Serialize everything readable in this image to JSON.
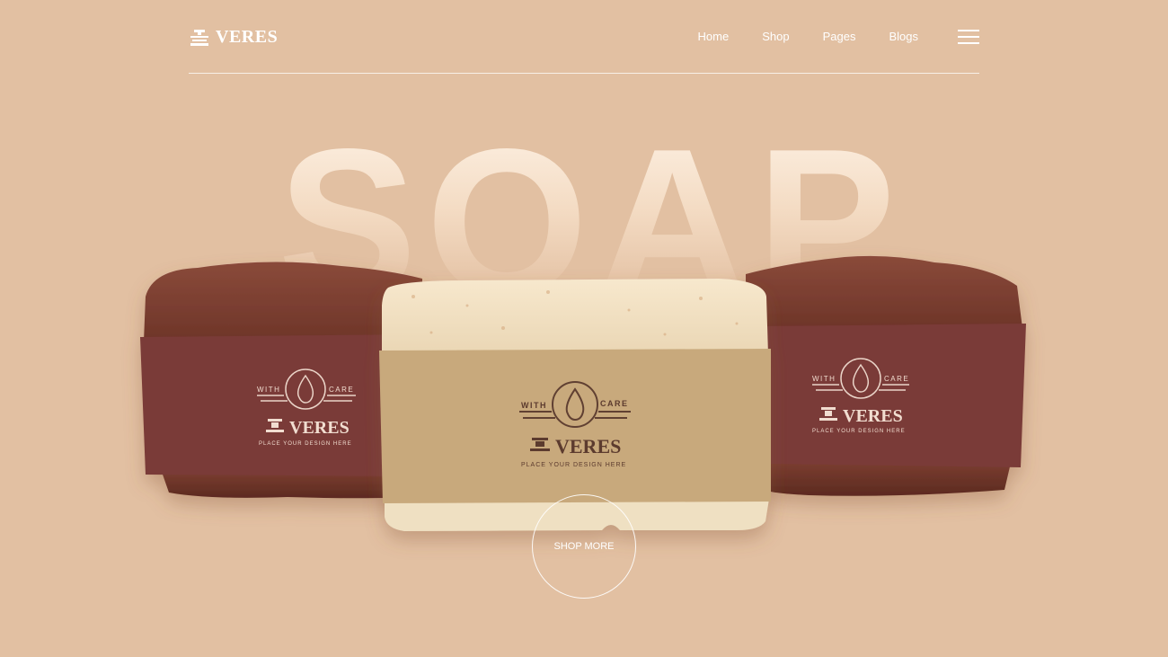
{
  "brand": {
    "name": "VERES",
    "icon": "soap-dispenser-icon"
  },
  "nav": {
    "links": [
      "Home",
      "Shop",
      "Pages",
      "Blogs"
    ],
    "menu_icon": "hamburger-menu-icon"
  },
  "hero": {
    "headline": "SOAP",
    "cta_label": "SHOP MORE"
  },
  "products": {
    "label_with": "WITH",
    "label_care": "CARE",
    "label_brand": "VERES",
    "label_tagline": "PLACE YOUR DESIGN HERE"
  },
  "colors": {
    "background": "#e2c0a2",
    "accent_dark_wrap": "#7a3a37",
    "accent_light_wrap": "#c8a97c",
    "text": "#ffffff"
  }
}
